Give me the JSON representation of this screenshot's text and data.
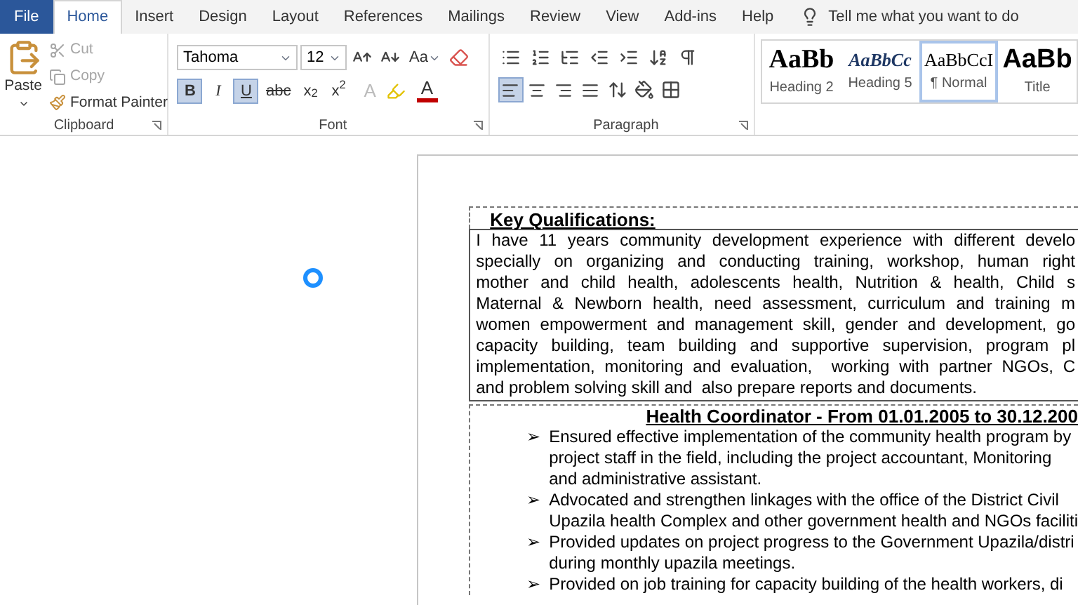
{
  "tabs": [
    {
      "label": "File",
      "kind": "file",
      "selected": false
    },
    {
      "label": "Home",
      "kind": "tab",
      "selected": true
    },
    {
      "label": "Insert",
      "kind": "tab",
      "selected": false
    },
    {
      "label": "Design",
      "kind": "tab",
      "selected": false
    },
    {
      "label": "Layout",
      "kind": "tab",
      "selected": false
    },
    {
      "label": "References",
      "kind": "tab",
      "selected": false
    },
    {
      "label": "Mailings",
      "kind": "tab",
      "selected": false
    },
    {
      "label": "Review",
      "kind": "tab",
      "selected": false
    },
    {
      "label": "View",
      "kind": "tab",
      "selected": false
    },
    {
      "label": "Add-ins",
      "kind": "tab",
      "selected": false
    },
    {
      "label": "Help",
      "kind": "tab",
      "selected": false
    }
  ],
  "tell_me": "Tell me what you want to do",
  "clipboard": {
    "paste": "Paste",
    "cut": {
      "label": "Cut",
      "disabled": true
    },
    "copy": {
      "label": "Copy",
      "disabled": true
    },
    "format_painter": "Format Painter",
    "label": "Clipboard"
  },
  "font": {
    "name": "Tahoma",
    "size": "12",
    "case": "Aa",
    "effects": "A",
    "font_color": "A",
    "label": "Font",
    "format_buttons": [
      {
        "label": "B",
        "kind": "bold",
        "pressed": true
      },
      {
        "label": "I",
        "kind": "italic",
        "pressed": false
      },
      {
        "label": "U",
        "kind": "underline",
        "pressed": true
      },
      {
        "label": "abc",
        "kind": "strike",
        "pressed": false
      },
      {
        "label": "x$_{2}$",
        "kind": "script",
        "pressed": false
      },
      {
        "label": "x$^{2}$",
        "kind": "script",
        "pressed": false
      }
    ]
  },
  "paragraph": {
    "label": "Paragraph",
    "alignments": [
      {
        "kind": "left",
        "selected": true
      },
      {
        "kind": "center",
        "selected": false
      },
      {
        "kind": "right",
        "selected": false
      },
      {
        "kind": "justify",
        "selected": false
      }
    ]
  },
  "styles": [
    {
      "preview": "AaBb",
      "name": "Heading 2",
      "kind": "heading2",
      "selected": false
    },
    {
      "preview": "AaBbCc",
      "name": "Heading 5",
      "kind": "heading5",
      "selected": false
    },
    {
      "preview": "AaBbCcI",
      "name": "¶ Normal",
      "kind": "normal",
      "selected": true
    },
    {
      "preview": "AaBb",
      "name": "Title",
      "kind": "title",
      "selected": false
    }
  ],
  "document": {
    "section_title": "Key Qualifications:",
    "summary_lines": [
      "I have 11 years community development experience with different develo",
      "specially on organizing and conducting training, workshop, human right",
      "mother and child health, adolescents health, Nutrition & health, Child s",
      "Maternal & Newborn health, need assessment, curriculum and training m",
      "women empowerment and management skill, gender and development, go",
      "capacity building, team building and supportive supervision, program pl",
      "implementation, monitoring and evaluation,  working with partner NGOs, C",
      "and problem solving skill and  also prepare reports and documents."
    ],
    "job_title": "Health Coordinator - From 01.01.2005 to 30.12.200",
    "bullet": "➢",
    "bullets": [
      {
        "lines": [
          "Ensured effective implementation of the community health program by",
          "project staff in the field, including the project accountant, Monitoring",
          "and administrative assistant."
        ]
      },
      {
        "lines": [
          "Advocated and strengthen linkages with the office of the District Civil",
          "Upazila health Complex and other government health and NGOs faciliti"
        ]
      },
      {
        "lines": [
          "Provided updates on project progress to the Government Upazila/distri",
          "during monthly upazila meetings."
        ]
      },
      {
        "lines": [
          "Provided on job training for capacity building of the health workers, di"
        ]
      }
    ]
  }
}
